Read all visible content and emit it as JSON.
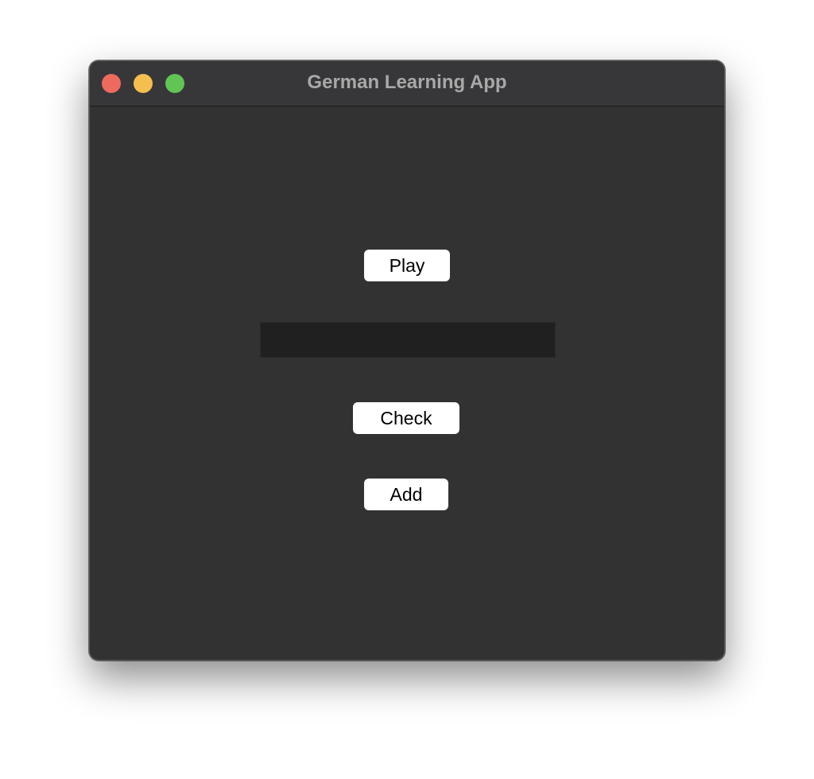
{
  "window": {
    "title": "German Learning App"
  },
  "traffic_lights": {
    "close": "#ee6a5f",
    "minimize": "#f5bf4f",
    "zoom": "#61c554"
  },
  "main": {
    "play_label": "Play",
    "answer_value": "",
    "check_label": "Check",
    "add_label": "Add"
  }
}
